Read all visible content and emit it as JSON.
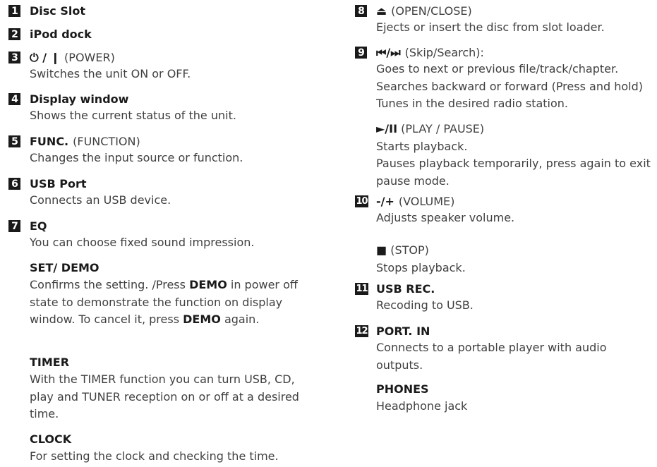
{
  "left": {
    "disc_slot": {
      "num": "1",
      "title": "Disc Slot"
    },
    "ipod_dock": {
      "num": "2",
      "title": "iPod dock"
    },
    "power": {
      "num": "3",
      "symbol": "⏻ / ❙",
      "paren": "(POWER)",
      "desc": "Switches the unit ON or OFF."
    },
    "display": {
      "num": "4",
      "title": "Display window",
      "desc": "Shows the current status of the unit."
    },
    "func": {
      "num": "5",
      "title": "FUNC.",
      "paren": "(FUNCTION)",
      "desc": "Changes the input source or function."
    },
    "usb": {
      "num": "6",
      "title": "USB Port",
      "desc": "Connects an USB device."
    },
    "eq": {
      "num": "7",
      "title": "EQ",
      "desc": "You can choose fixed sound impression."
    },
    "set_demo": {
      "title": "SET/ DEMO",
      "line1": "Confirms the setting. /Press ",
      "demo": "DEMO",
      "line1_tail": " in power off",
      "line2": "state to demonstrate the function on display",
      "line3_head": "window. To cancel it, press ",
      "demo2": "DEMO",
      "line3_tail": " again."
    },
    "timer": {
      "title": "TIMER",
      "lines": [
        "With the TIMER function you can turn USB, CD,",
        "play and TUNER reception on or off at a desired",
        "time."
      ]
    },
    "clock": {
      "title": "CLOCK",
      "desc": "For setting the clock and checking the time."
    }
  },
  "right": {
    "open_close": {
      "num": "8",
      "symbol": "⏏",
      "paren": "(OPEN/CLOSE)",
      "desc": "Ejects or insert the disc from slot loader."
    },
    "skip": {
      "num": "9",
      "symbol": "⏮/⏭",
      "paren": "(Skip/Search):",
      "lines": [
        "Goes to next or previous file/track/chapter.",
        "Searches backward or forward (Press and hold)",
        "Tunes in the desired radio station."
      ]
    },
    "play_pause": {
      "symbol": "►/II",
      "paren": "(PLAY / PAUSE)",
      "lines": [
        "Starts playback.",
        "Pauses playback temporarily, press again to exit",
        "pause mode."
      ]
    },
    "volume": {
      "num": "10",
      "title": "-/+",
      "paren": "(VOLUME)",
      "desc": "Adjusts speaker volume."
    },
    "stop": {
      "symbol": "■",
      "paren": "(STOP)",
      "desc": "Stops playback."
    },
    "usb_rec": {
      "num": "11",
      "title": "USB REC.",
      "desc": "Recoding to USB."
    },
    "port_in": {
      "num": "12",
      "title": "PORT. IN",
      "lines": [
        "Connects to a portable player with audio",
        "outputs."
      ]
    },
    "phones": {
      "title": "PHONES",
      "desc": "Headphone jack"
    }
  }
}
